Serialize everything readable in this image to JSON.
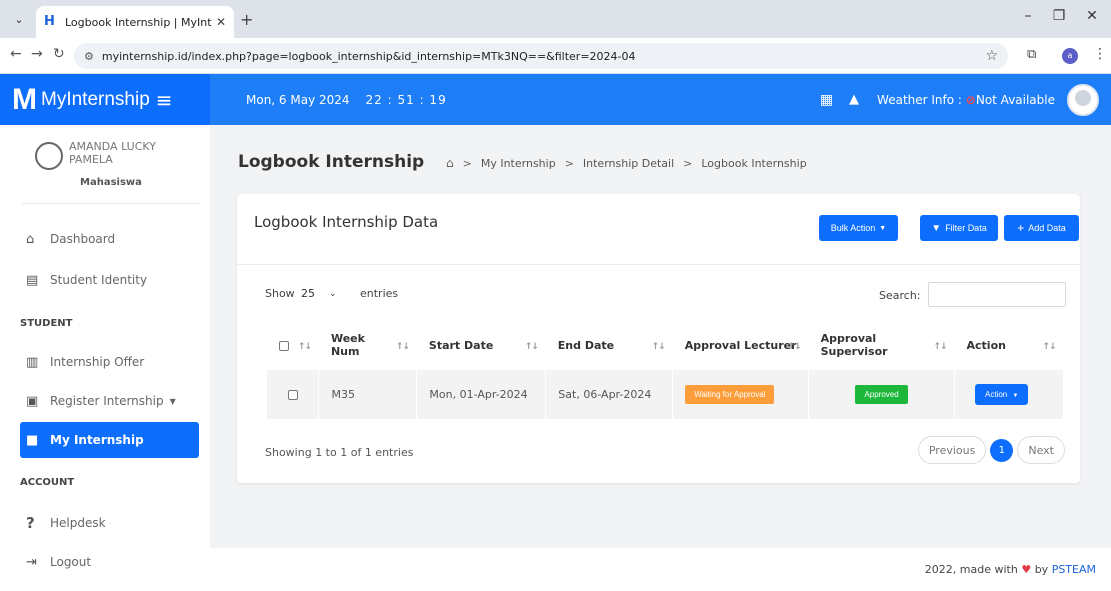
{
  "browser": {
    "tab_title": "Logbook Internship | MyInterns",
    "tab_close": "✕",
    "new_tab": "+",
    "url": "myinternship.id/index.php?page=logbook_internship&id_internship=MTk3NQ==&filter=2024-04",
    "profile_initial": "a"
  },
  "header": {
    "brand": "MyInternship",
    "date": "Mon, 6 May 2024",
    "time": "22 : 51 : 19",
    "weather_label": "Weather Info : ",
    "weather_value": "Not Available"
  },
  "user": {
    "name": "AMANDA LUCKY PAMELA",
    "role": "Mahasiswa"
  },
  "sidebar": {
    "items": [
      {
        "label": "Dashboard",
        "icon": "home-icon"
      },
      {
        "label": "Student Identity",
        "icon": "id-card-icon"
      },
      {
        "label": "Internship Offer",
        "icon": "building-icon"
      },
      {
        "label": "Register Internship",
        "icon": "form-icon"
      },
      {
        "label": "My Internship",
        "icon": "briefcase-icon"
      },
      {
        "label": "Helpdesk",
        "icon": "question-icon"
      },
      {
        "label": "Logout",
        "icon": "logout-icon"
      }
    ],
    "sections": {
      "student": "STUDENT",
      "account": "ACCOUNT"
    }
  },
  "page": {
    "title": "Logbook Internship",
    "breadcrumb": [
      "My Internship",
      "Internship Detail",
      "Logbook Internship"
    ]
  },
  "card": {
    "title": "Logbook Internship Data",
    "buttons": {
      "bulk": "Bulk Action",
      "filter": "Filter Data",
      "add": "Add Data"
    },
    "show_label": "Show",
    "page_size": "25",
    "entries_label": "entries",
    "search_label": "Search:",
    "search_value": "",
    "columns": [
      "Week Num",
      "Start Date",
      "End Date",
      "Approval Lecturer",
      "Approval Supervisor",
      "Action"
    ],
    "rows": [
      {
        "week": "M35",
        "start": "Mon, 01-Apr-2024",
        "end": "Sat, 06-Apr-2024",
        "lecturer": "Waiting for Approval",
        "supervisor": "Approved",
        "action": "Action"
      }
    ],
    "showing_text": "Showing 1 to 1 of 1 entries",
    "pager": {
      "prev": "Previous",
      "current": "1",
      "next": "Next"
    }
  },
  "footer": {
    "text_before": "2022, made with",
    "text_by": "by",
    "link": "PSTEAM"
  },
  "colors": {
    "primary": "#0d6efd",
    "topbar": "#1e7ef8",
    "waiting": "#fd9e3b",
    "approved": "#1db83b"
  }
}
